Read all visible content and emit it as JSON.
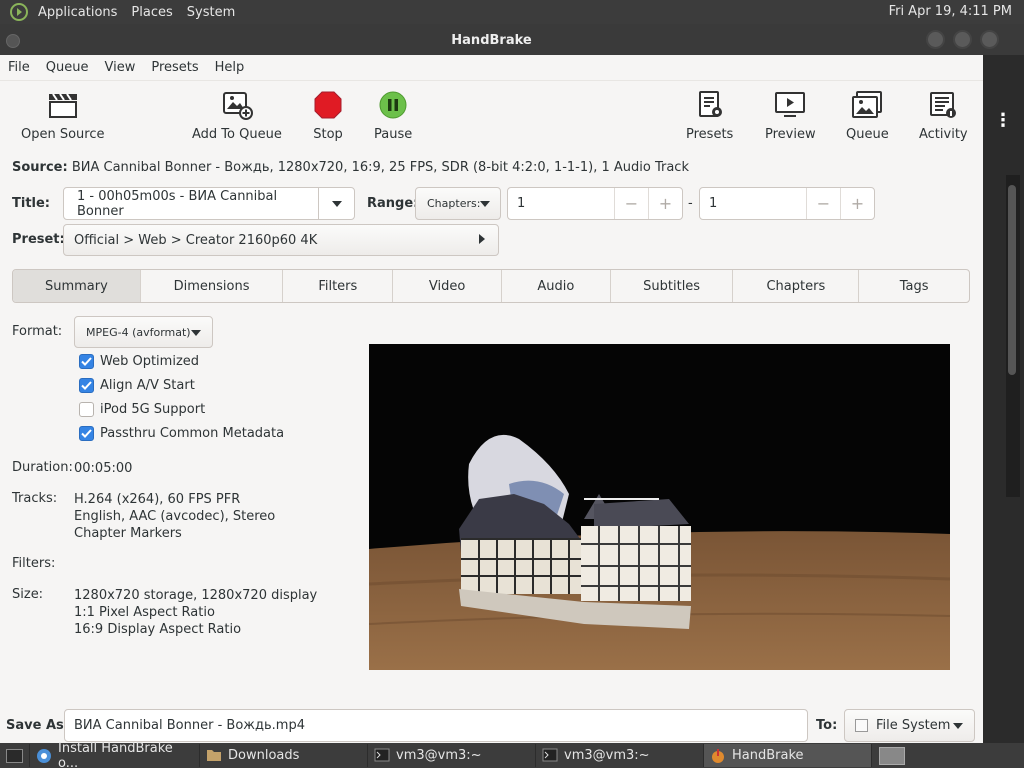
{
  "top_panel": {
    "menus": [
      "Applications",
      "Places",
      "System"
    ],
    "clock": "Fri Apr 19,  4:11 PM"
  },
  "window": {
    "title": "HandBrake"
  },
  "menubar": [
    "File",
    "Queue",
    "View",
    "Presets",
    "Help"
  ],
  "toolbar": {
    "open_source": "Open Source",
    "add_to_queue": "Add To Queue",
    "stop": "Stop",
    "pause": "Pause",
    "presets": "Presets",
    "preview": "Preview",
    "queue": "Queue",
    "activity": "Activity"
  },
  "source": {
    "label": "Source:",
    "value": "ВИА Cannibal Bonner - Вождь, 1280x720, 16:9, 25 FPS, SDR (8-bit 4:2:0, 1-1-1), 1 Audio Track"
  },
  "title_row": {
    "label": "Title:",
    "value": "1 - 00h05m00s - ВИА Cannibal Bonner",
    "range_label": "Range:",
    "range_mode": "Chapters:",
    "range_start": "1",
    "range_dash": "-",
    "range_end": "1",
    "minus": "−",
    "plus": "+"
  },
  "preset_row": {
    "label": "Preset:",
    "value": "Official > Web > Creator 2160p60 4K"
  },
  "tabs": [
    "Summary",
    "Dimensions",
    "Filters",
    "Video",
    "Audio",
    "Subtitles",
    "Chapters",
    "Tags"
  ],
  "summary": {
    "format_label": "Format:",
    "format_value": "MPEG-4 (avformat)",
    "options": [
      {
        "label": "Web Optimized",
        "checked": true
      },
      {
        "label": "Align A/V Start",
        "checked": true
      },
      {
        "label": "iPod 5G Support",
        "checked": false
      },
      {
        "label": "Passthru Common Metadata",
        "checked": true
      }
    ],
    "duration_label": "Duration:",
    "duration_value": "00:05:00",
    "tracks_label": "Tracks:",
    "tracks": [
      "H.264 (x264), 60 FPS PFR",
      "English, AAC (avcodec), Stereo",
      "Chapter Markers"
    ],
    "filters_label": "Filters:",
    "size_label": "Size:",
    "size": [
      "1280x720 storage, 1280x720 display",
      "1:1 Pixel Aspect Ratio",
      "16:9 Display Aspect Ratio"
    ]
  },
  "save": {
    "label": "Save As:",
    "value": "ВИА Cannibal Bonner - Вождь.mp4",
    "to_label": "To:",
    "to_value": "File System"
  },
  "taskbar": [
    {
      "label": "Install HandBrake o...",
      "icon": "chromium-icon",
      "active": false
    },
    {
      "label": "Downloads",
      "icon": "folder-icon",
      "active": false
    },
    {
      "label": "vm3@vm3:~",
      "icon": "terminal-icon",
      "active": false
    },
    {
      "label": "vm3@vm3:~",
      "icon": "terminal-icon",
      "active": false
    },
    {
      "label": "HandBrake",
      "icon": "handbrake-icon",
      "active": true
    }
  ],
  "colors": {
    "accent": "#3584e4",
    "stop": "#e01b24",
    "pause": "#5cb85c"
  }
}
